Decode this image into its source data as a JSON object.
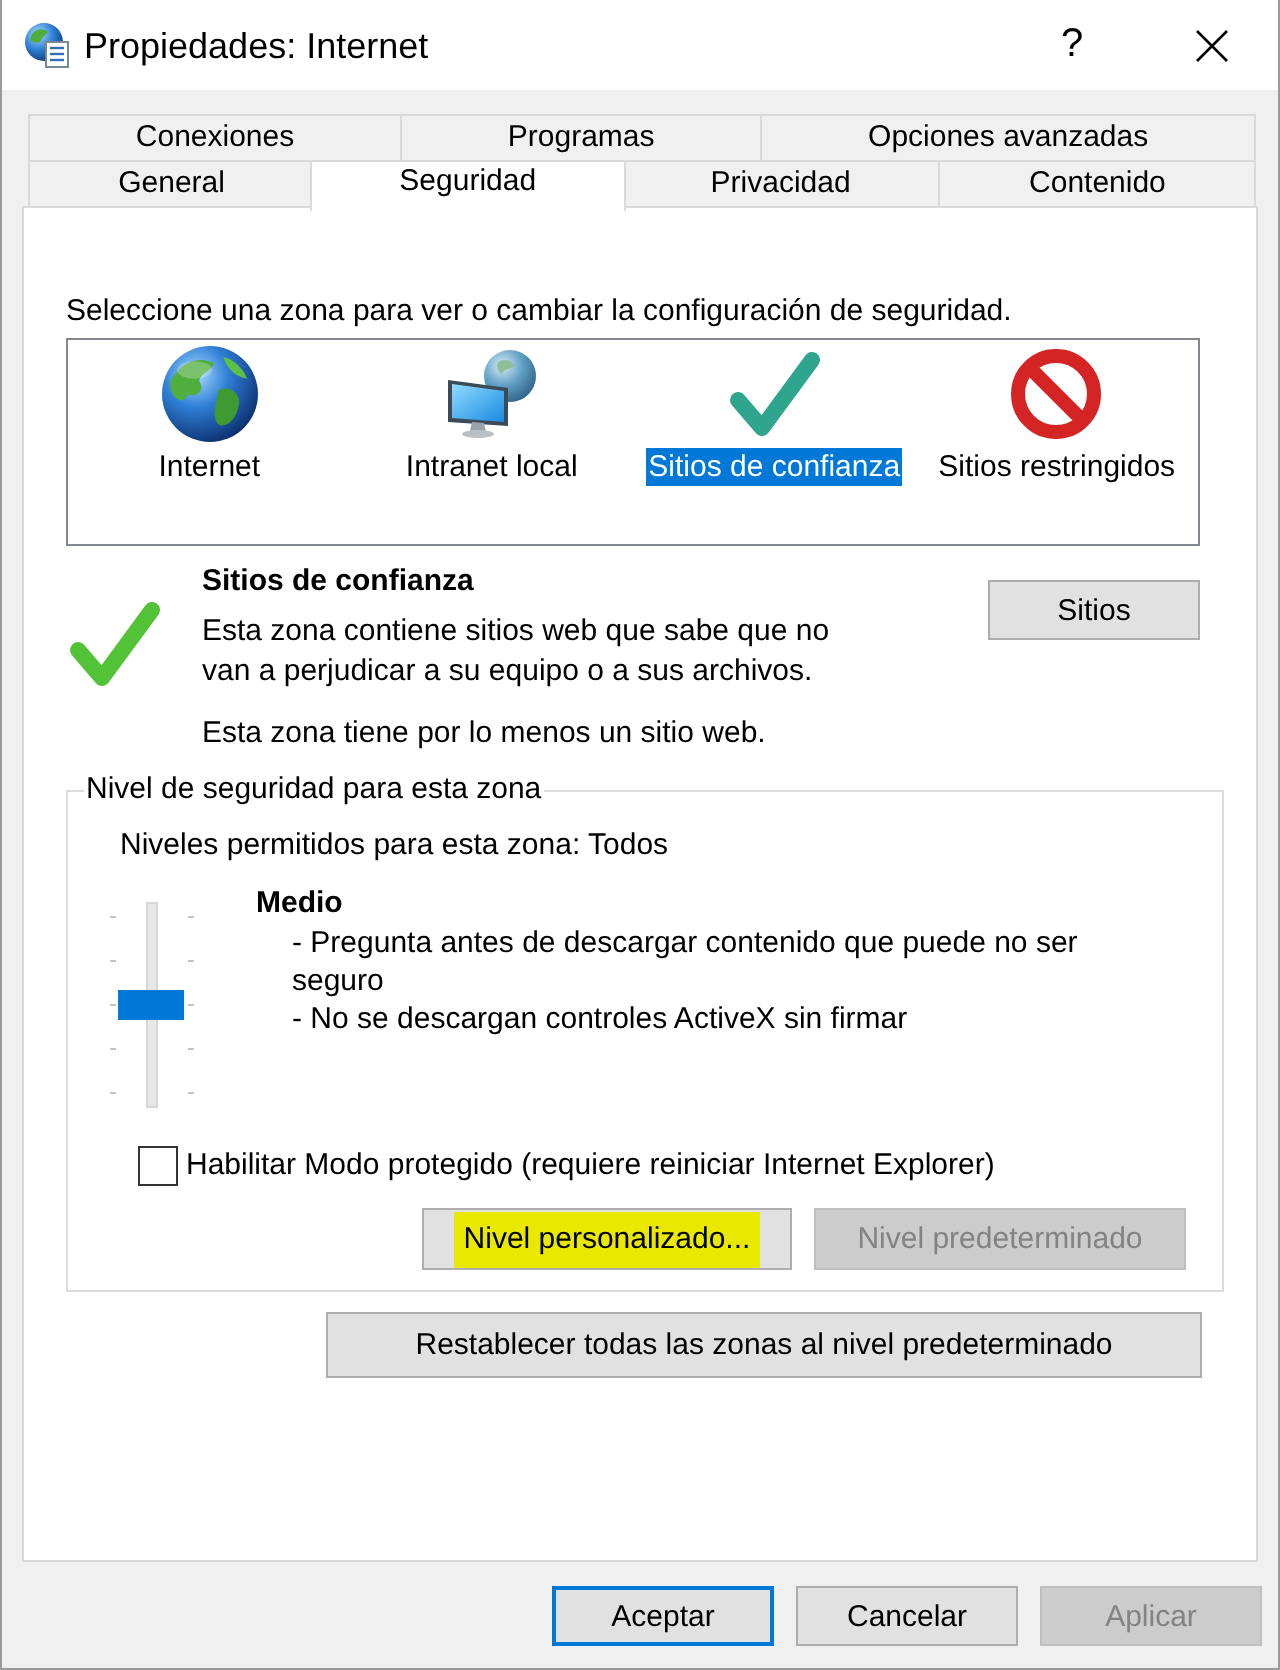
{
  "window": {
    "title": "Propiedades: Internet",
    "help_button": "?"
  },
  "tab_rows": [
    {
      "tabs": [
        {
          "label": "Conexiones",
          "selected": false
        },
        {
          "label": "Programas",
          "selected": false
        },
        {
          "label": "Opciones avanzadas",
          "selected": false
        }
      ]
    },
    {
      "tabs": [
        {
          "label": "General",
          "selected": false
        },
        {
          "label": "Seguridad",
          "selected": true
        },
        {
          "label": "Privacidad",
          "selected": false
        },
        {
          "label": "Contenido",
          "selected": false
        }
      ]
    }
  ],
  "instruction": "Seleccione una zona para ver o cambiar la configuración de seguridad.",
  "zones": [
    {
      "kind": "internet",
      "label": "Internet",
      "selected": false
    },
    {
      "kind": "intranet",
      "label": "Intranet local",
      "selected": false
    },
    {
      "kind": "trusted",
      "label": "Sitios de confianza",
      "selected": true
    },
    {
      "kind": "restricted",
      "label": "Sitios restringidos",
      "selected": false
    }
  ],
  "zone_details": {
    "kind": "trusted",
    "title": "Sitios de confianza",
    "description": "Esta zona contiene sitios web que sabe que no van a perjudicar a su equipo o a sus archivos.",
    "note": "Esta zona tiene por lo menos un sitio web.",
    "sites_button": "Sitios"
  },
  "security_level": {
    "legend": "Nivel de seguridad para esta zona",
    "allowed": "Niveles permitidos para esta zona: Todos",
    "level": 0.5,
    "level_name": "Medio",
    "details": [
      "- Pregunta antes de descargar contenido que puede no ser seguro",
      "- No se descargan controles ActiveX sin firmar"
    ],
    "protected_mode": {
      "label": "Habilitar Modo protegido (requiere reiniciar Internet Explorer)",
      "checked": false
    },
    "buttons": [
      {
        "label": "Nivel personalizado...",
        "disabled": false,
        "highlighted": true
      },
      {
        "label": "Nivel predeterminado",
        "disabled": true,
        "highlighted": false
      }
    ]
  },
  "reset_button": "Restablecer todas las zonas al nivel predeterminado",
  "dialog_buttons": [
    {
      "label": "Aceptar",
      "default": true,
      "disabled": false
    },
    {
      "label": "Cancelar",
      "default": false,
      "disabled": false
    },
    {
      "label": "Aplicar",
      "default": false,
      "disabled": true
    }
  ]
}
